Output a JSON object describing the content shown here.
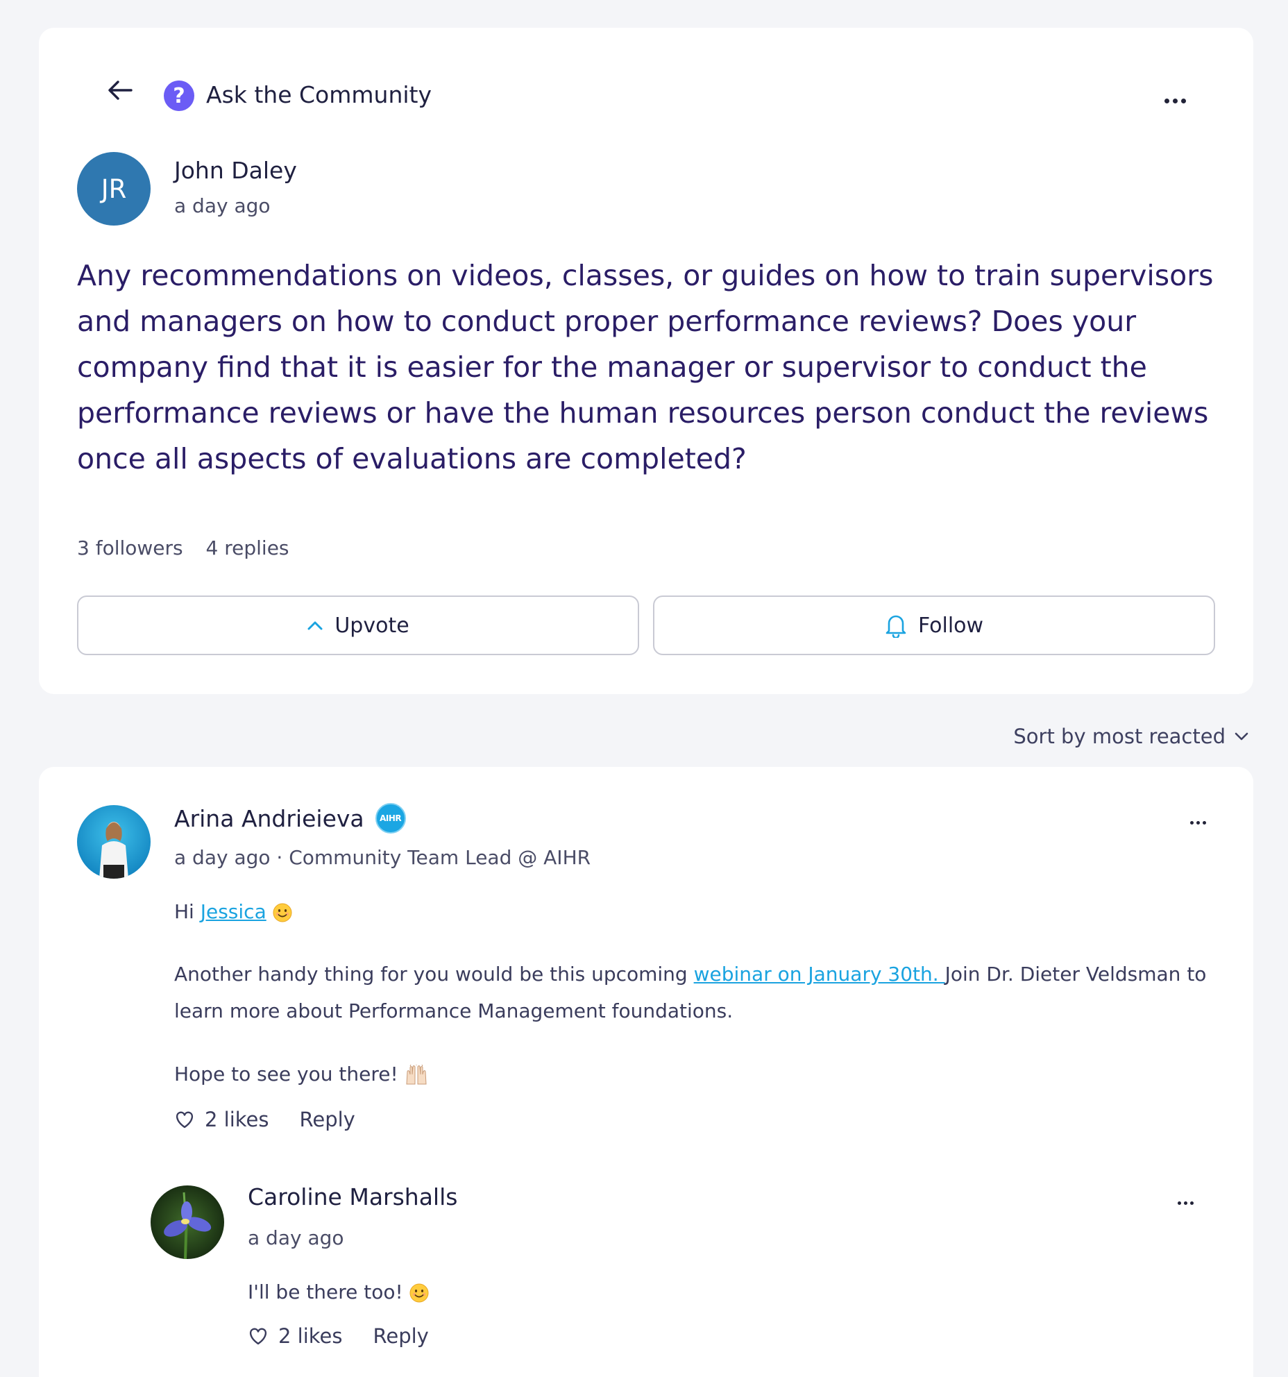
{
  "header": {
    "title": "Ask the Community",
    "back_icon": "arrow-left-icon",
    "help_icon": "question-circle-icon",
    "more_icon": "more-horizontal-icon"
  },
  "post": {
    "avatar_initials": "JR",
    "author": "John Daley",
    "time": "a day ago",
    "question": "Any recommendations on videos, classes, or guides on how to train supervisors and managers on how to conduct proper performance reviews? Does your company find that it is easier for the manager or supervisor to conduct the performance reviews or have the human resources person conduct the reviews once all aspects of evaluations are completed?",
    "followers": "3 followers",
    "replies": "4 replies",
    "upvote_label": "Upvote",
    "follow_label": "Follow"
  },
  "sort": {
    "label": "Sort by most reacted"
  },
  "comments": [
    {
      "author": "Arina Andrieieva",
      "badge": "AIHR",
      "meta": "a day ago · Community Team Lead @ AIHR",
      "greeting_prefix": "Hi ",
      "mention": "Jessica",
      "para2_prefix": "Another handy thing for you would be this upcoming ",
      "para2_link": "webinar on January 30th. ",
      "para2_suffix": "Join Dr. Dieter Veldsman to learn more about Performance Management foundations.",
      "para3": "Hope to see you there!",
      "likes": "2 likes",
      "reply_label": "Reply"
    },
    {
      "author": "Caroline Marshalls",
      "meta": "a day ago",
      "text": "I'll be there too!",
      "likes": "2 likes",
      "reply_label": "Reply"
    }
  ],
  "colors": {
    "accent": "#1aa3e0",
    "question_text": "#2a1d66",
    "help_icon_bg": "#6b5cf5",
    "avatar_bg": "#2f78b0"
  }
}
